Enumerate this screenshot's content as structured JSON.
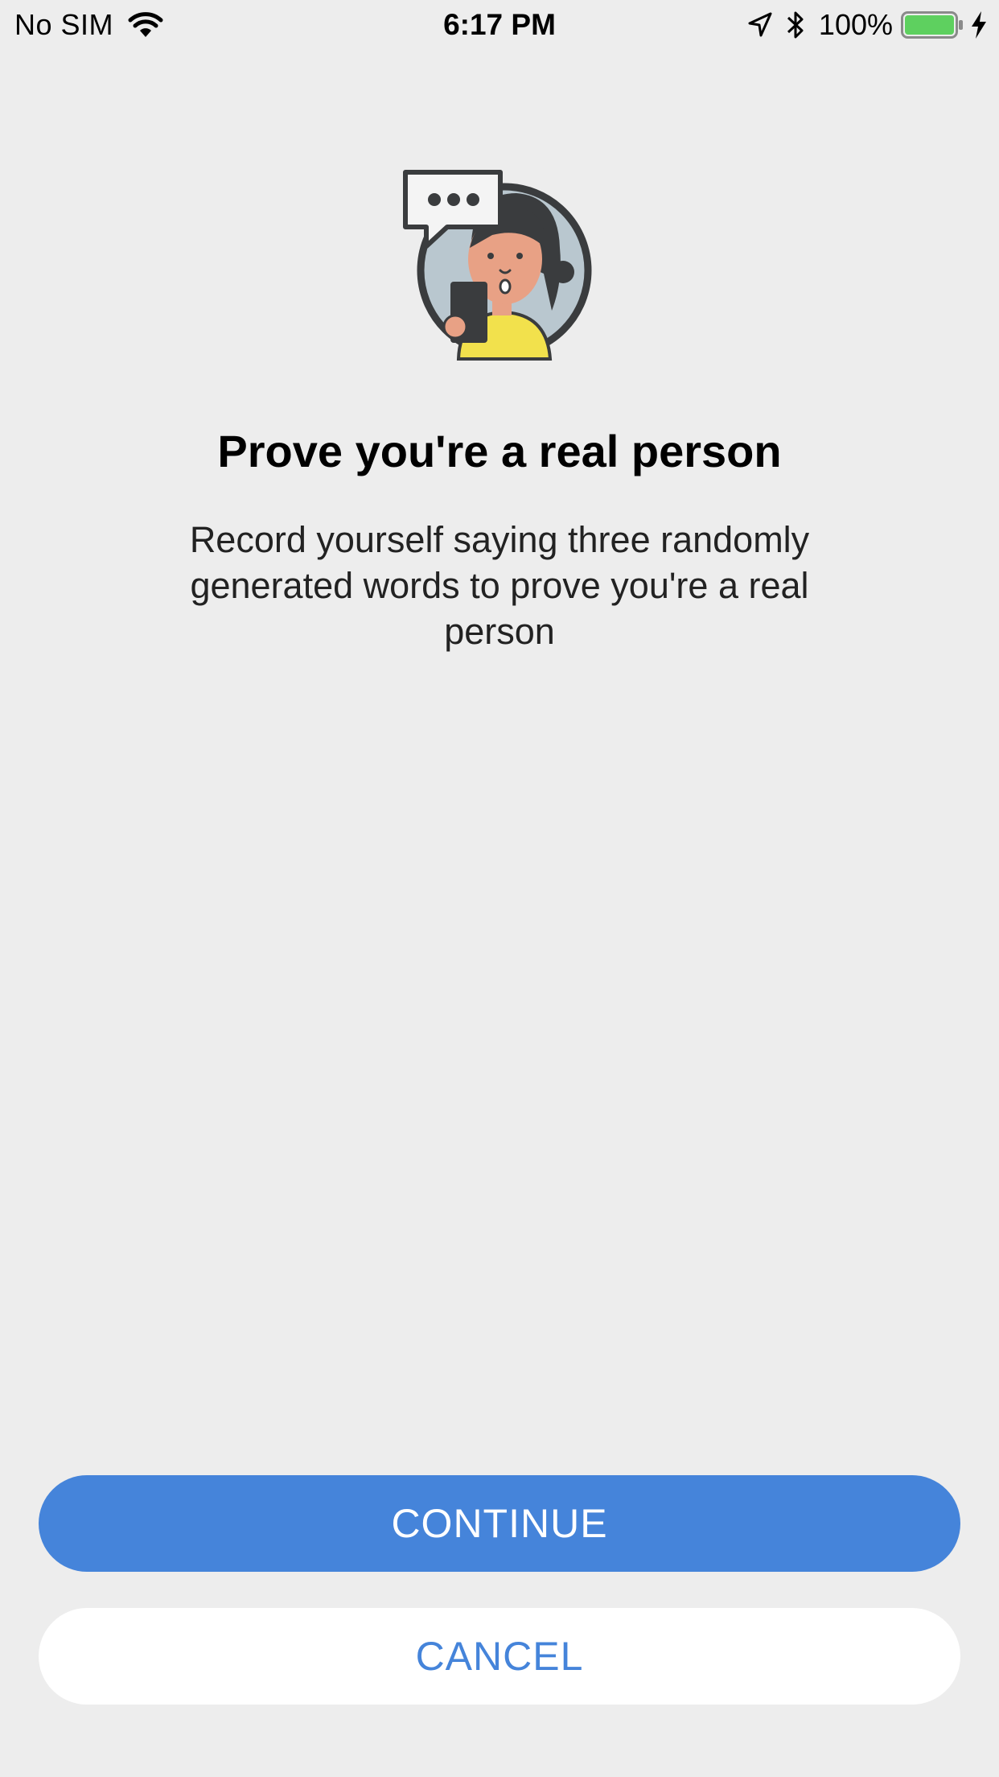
{
  "status_bar": {
    "carrier": "No SIM",
    "time": "6:17 PM",
    "battery_percent": "100%",
    "battery_color": "#5ed05f"
  },
  "illustration": {
    "icon": "person-speaking-icon",
    "colors": {
      "circle": "#b9c7cf",
      "skin": "#e8a185",
      "shirt": "#f2e14c",
      "hair": "#3a3c3e"
    }
  },
  "content": {
    "title": "Prove you're a real person",
    "description": "Record yourself saying three randomly generated words to prove you're a real person"
  },
  "actions": {
    "continue_label": "CONTINUE",
    "cancel_label": "CANCEL",
    "accent_color": "#4584da"
  }
}
